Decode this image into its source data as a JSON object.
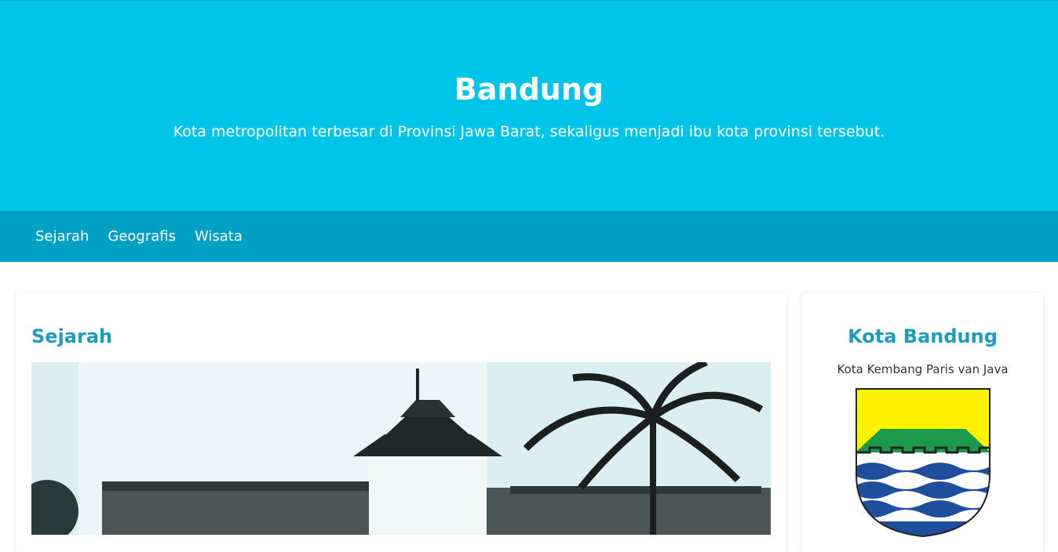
{
  "hero": {
    "title": "Bandung",
    "subtitle": "Kota metropolitan terbesar di Provinsi Jawa Barat, sekaligus menjadi ibu kota provinsi tersebut."
  },
  "nav": {
    "items": [
      {
        "label": "Sejarah"
      },
      {
        "label": "Geografis"
      },
      {
        "label": "Wisata"
      }
    ]
  },
  "main": {
    "section_title": "Sejarah",
    "image": "gedung-sate-historical-photo"
  },
  "sidebar": {
    "title": "Kota Bandung",
    "tagline": "Kota Kembang Paris van Java",
    "emblem": "bandung-coat-of-arms"
  },
  "colors": {
    "hero_bg": "#00c5e8",
    "nav_bg": "#00a0c4",
    "accent": "#1e9bc0"
  }
}
